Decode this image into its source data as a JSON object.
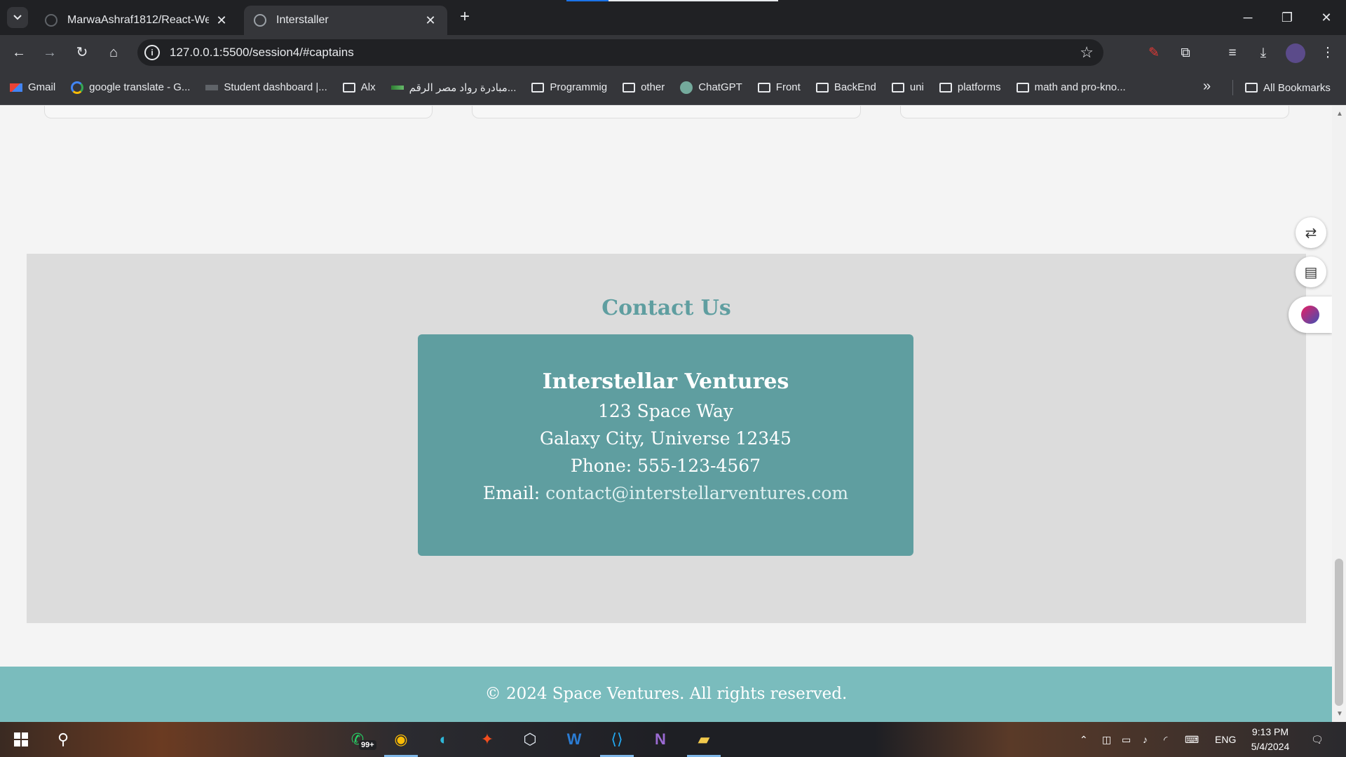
{
  "browser": {
    "tabs": [
      {
        "title": "MarwaAshraf1812/React-Web-D",
        "active": false
      },
      {
        "title": "Interstaller",
        "active": true
      }
    ],
    "url": "127.0.0.1:5500/session4/#captains",
    "bookmarks": [
      {
        "label": "Gmail",
        "icon": "gmail-icon"
      },
      {
        "label": "google translate - G...",
        "icon": "google-icon"
      },
      {
        "label": "Student dashboard |...",
        "icon": "alx-icon"
      },
      {
        "label": "Alx",
        "icon": "folder-icon"
      },
      {
        "label": "مبادرة رواد مصر الرقم...",
        "icon": "rowad-icon"
      },
      {
        "label": "Programmig",
        "icon": "folder-icon"
      },
      {
        "label": "other",
        "icon": "folder-icon"
      },
      {
        "label": "ChatGPT",
        "icon": "chatgpt-icon"
      },
      {
        "label": "Front",
        "icon": "folder-icon"
      },
      {
        "label": "BackEnd",
        "icon": "folder-icon"
      },
      {
        "label": "uni",
        "icon": "folder-icon"
      },
      {
        "label": "platforms",
        "icon": "folder-icon"
      },
      {
        "label": "math and pro-kno...",
        "icon": "folder-icon"
      }
    ],
    "all_bookmarks_label": "All Bookmarks"
  },
  "page": {
    "contact": {
      "heading": "Contact Us",
      "company": "Interstellar Ventures",
      "address_line1": "123 Space Way",
      "address_line2": "Galaxy City, Universe 12345",
      "phone": "Phone: 555-123-4567",
      "email_label": "Email:",
      "email": "contact@interstellarventures.com"
    },
    "footer": "© 2024 Space Ventures. All rights reserved.",
    "colors": {
      "accent": "#5f9ea0",
      "footer_bg": "#7abcbd",
      "section_bg": "#dcdcdc"
    }
  },
  "taskbar": {
    "whatsapp_badge": "99+",
    "language": "ENG",
    "time": "9:13 PM",
    "date": "5/4/2024"
  }
}
